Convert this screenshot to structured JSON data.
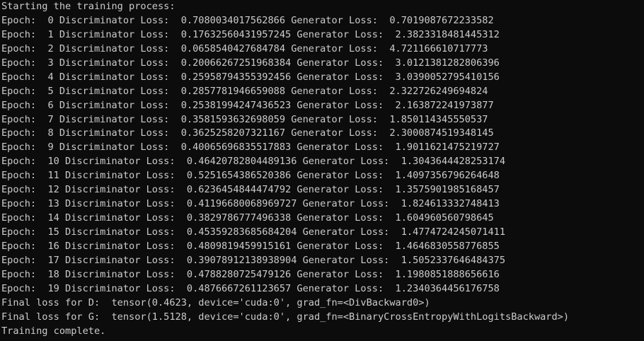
{
  "terminal": {
    "background": "#0c0c0c",
    "foreground": "#cccccc",
    "header": "Starting the training process:",
    "epochs": [
      "Epoch:  0 Discriminator Loss:  0.7080034017562866 Generator Loss:  0.7019087672233582",
      "Epoch:  1 Discriminator Loss:  0.17632560431957245 Generator Loss:  2.3823318481445312",
      "Epoch:  2 Discriminator Loss:  0.0658540427684784 Generator Loss:  4.721166610717773",
      "Epoch:  3 Discriminator Loss:  0.20066267251968384 Generator Loss:  3.0121381282806396",
      "Epoch:  4 Discriminator Loss:  0.25958794355392456 Generator Loss:  3.0390052795410156",
      "Epoch:  5 Discriminator Loss:  0.2857781946659088 Generator Loss:  2.322726249694824",
      "Epoch:  6 Discriminator Loss:  0.25381994247436523 Generator Loss:  2.163872241973877",
      "Epoch:  7 Discriminator Loss:  0.3581593632698059 Generator Loss:  1.850114345550537",
      "Epoch:  8 Discriminator Loss:  0.3625258207321167 Generator Loss:  2.3000874519348145",
      "Epoch:  9 Discriminator Loss:  0.40065696835517883 Generator Loss:  1.9011621475219727",
      "Epoch:  10 Discriminator Loss:  0.46420782804489136 Generator Loss:  1.3043644428253174",
      "Epoch:  11 Discriminator Loss:  0.5251654386520386 Generator Loss:  1.4097356796264648",
      "Epoch:  12 Discriminator Loss:  0.6236454844474792 Generator Loss:  1.3575901985168457",
      "Epoch:  13 Discriminator Loss:  0.41196680068969727 Generator Loss:  1.824613332748413",
      "Epoch:  14 Discriminator Loss:  0.3829786777496338 Generator Loss:  1.604960560798645",
      "Epoch:  15 Discriminator Loss:  0.45359283685684204 Generator Loss:  1.4774724245071411",
      "Epoch:  16 Discriminator Loss:  0.4809819459915161 Generator Loss:  1.4646830558776855",
      "Epoch:  17 Discriminator Loss:  0.39078912138938904 Generator Loss:  1.5052337646484375",
      "Epoch:  18 Discriminator Loss:  0.4788280725479126 Generator Loss:  1.1980851888656616",
      "Epoch:  19 Discriminator Loss:  0.4876667261123657 Generator Loss:  1.2340364456176758"
    ],
    "final_d": "Final loss for D:  tensor(0.4623, device='cuda:0', grad_fn=<DivBackward0>)",
    "final_g": "Final loss for G:  tensor(1.5128, device='cuda:0', grad_fn=<BinaryCrossEntropyWithLogitsBackward>)",
    "footer": "Training complete."
  }
}
